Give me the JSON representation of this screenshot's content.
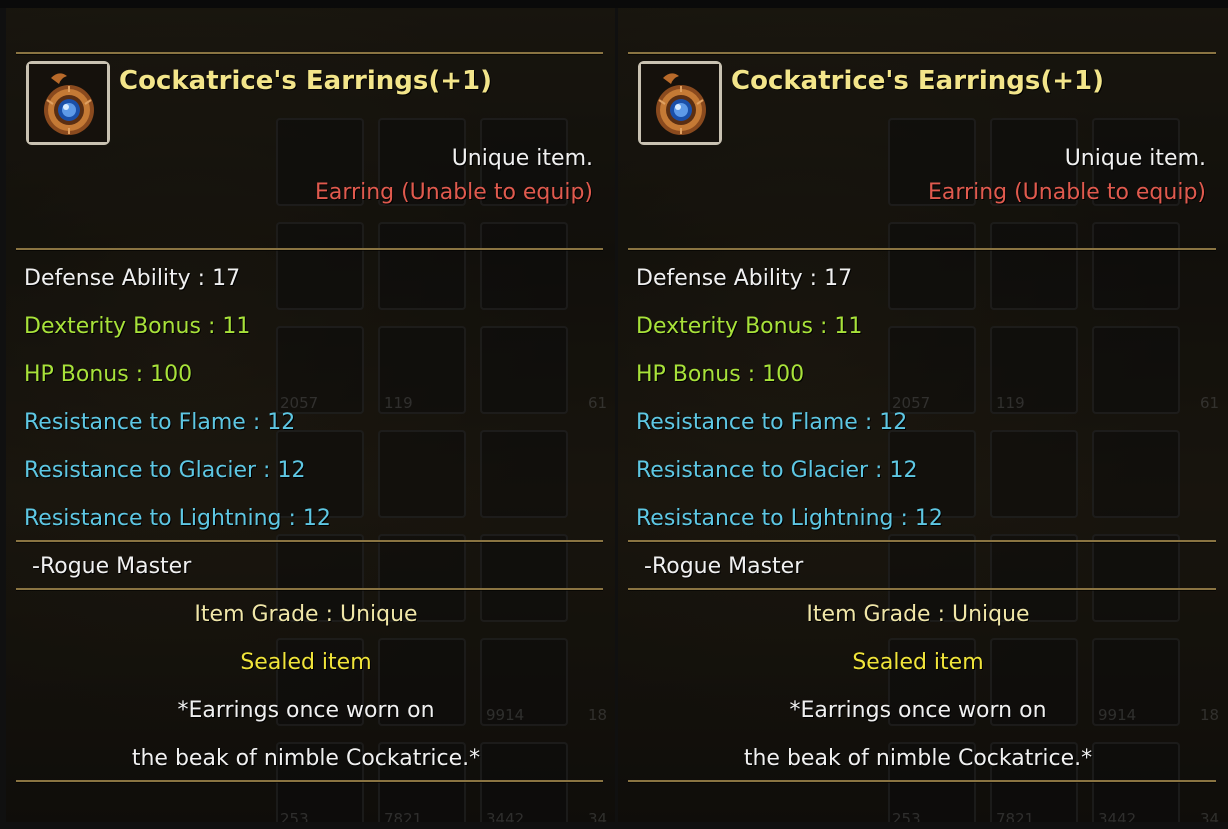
{
  "colors": {
    "title": "#f3e58a",
    "white": "#f0f0f0",
    "red": "#e05a4e",
    "green": "#a8e23a",
    "cyan": "#5ec7e3",
    "yellow": "#f0e43a",
    "rule": "#8a7442"
  },
  "tooltips": [
    {
      "icon": "earring-icon",
      "title": "Cockatrice's Earrings(+1)",
      "rarity": "Unique item.",
      "type_line": "Earring (Unable to equip)",
      "stats": [
        {
          "text": "Defense Ability : 17",
          "color": "white"
        },
        {
          "text": "Dexterity Bonus : 11",
          "color": "green"
        },
        {
          "text": "HP Bonus : 100",
          "color": "green"
        },
        {
          "text": "Resistance to Flame : 12",
          "color": "cyan"
        },
        {
          "text": "Resistance to Glacier : 12",
          "color": "cyan"
        },
        {
          "text": "Resistance to Lightning : 12",
          "color": "cyan"
        }
      ],
      "class_req": "-Rogue Master",
      "grade": "Item Grade : Unique",
      "sealed": "Sealed item",
      "desc_1": "*Earrings once worn on",
      "desc_2": "the beak of nimble Cockatrice.*"
    },
    {
      "icon": "earring-icon",
      "title": "Cockatrice's Earrings(+1)",
      "rarity": "Unique item.",
      "type_line": "Earring (Unable to equip)",
      "stats": [
        {
          "text": "Defense Ability : 17",
          "color": "white"
        },
        {
          "text": "Dexterity Bonus : 11",
          "color": "green"
        },
        {
          "text": "HP Bonus : 100",
          "color": "green"
        },
        {
          "text": "Resistance to Flame : 12",
          "color": "cyan"
        },
        {
          "text": "Resistance to Glacier : 12",
          "color": "cyan"
        },
        {
          "text": "Resistance to Lightning : 12",
          "color": "cyan"
        }
      ],
      "class_req": "-Rogue Master",
      "grade": "Item Grade : Unique",
      "sealed": "Sealed item",
      "desc_1": "*Earrings once worn on",
      "desc_2": "the beak of nimble Cockatrice.*"
    }
  ],
  "background_inventory": {
    "counts": [
      "2057",
      "119",
      "61",
      "9914",
      "18",
      "253",
      "7821",
      "3442",
      "34"
    ]
  }
}
